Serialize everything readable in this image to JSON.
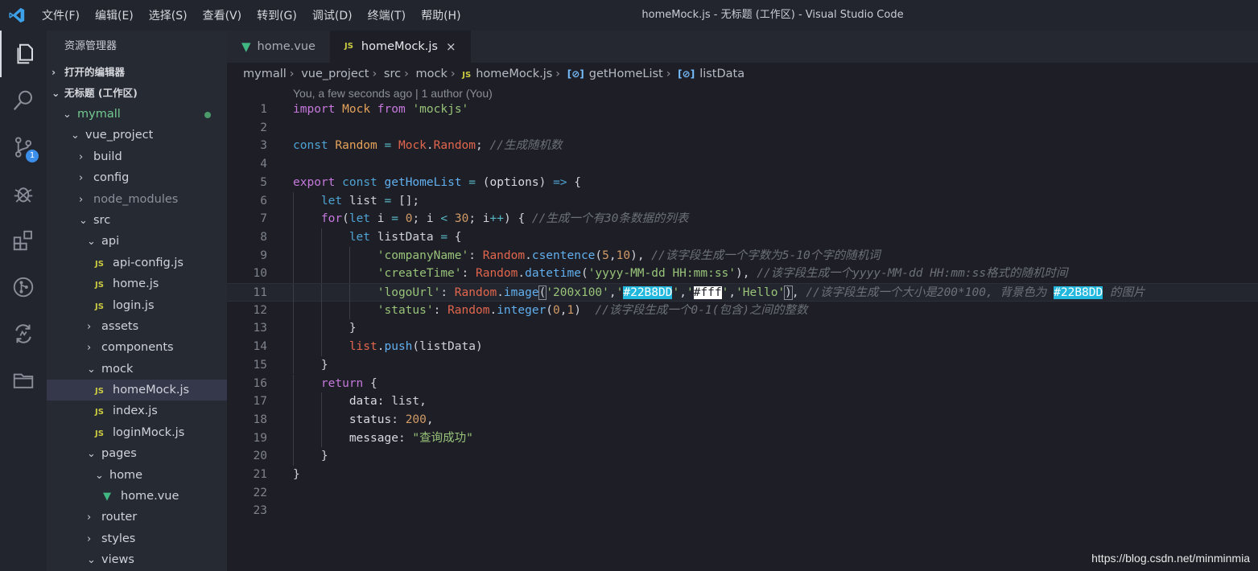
{
  "window": {
    "title": "homeMock.js - 无标题 (工作区) - Visual Studio Code"
  },
  "menu": [
    "文件(F)",
    "编辑(E)",
    "选择(S)",
    "查看(V)",
    "转到(G)",
    "调试(D)",
    "终端(T)",
    "帮助(H)"
  ],
  "activity_bar": {
    "items": [
      {
        "name": "explorer-icon",
        "active": true
      },
      {
        "name": "search-icon"
      },
      {
        "name": "source-control-icon",
        "badge": "1"
      },
      {
        "name": "debug-icon"
      },
      {
        "name": "extensions-icon"
      },
      {
        "name": "git-graph-icon"
      },
      {
        "name": "remote-sync-icon"
      },
      {
        "name": "folder-icon"
      }
    ]
  },
  "sidebar": {
    "title": "资源管理器",
    "sections": {
      "open_editors": "打开的编辑器",
      "workspace": "无标题 (工作区)"
    },
    "tree": [
      {
        "label": "mymall",
        "depth": 0,
        "kind": "folder-open",
        "style": "green",
        "dot": true
      },
      {
        "label": "vue_project",
        "depth": 1,
        "kind": "folder-open"
      },
      {
        "label": "build",
        "depth": 2,
        "kind": "folder"
      },
      {
        "label": "config",
        "depth": 2,
        "kind": "folder"
      },
      {
        "label": "node_modules",
        "depth": 2,
        "kind": "folder",
        "style": "dim"
      },
      {
        "label": "src",
        "depth": 2,
        "kind": "folder-open"
      },
      {
        "label": "api",
        "depth": 3,
        "kind": "folder-open"
      },
      {
        "label": "api-config.js",
        "depth": 4,
        "kind": "js"
      },
      {
        "label": "home.js",
        "depth": 4,
        "kind": "js"
      },
      {
        "label": "login.js",
        "depth": 4,
        "kind": "js"
      },
      {
        "label": "assets",
        "depth": 3,
        "kind": "folder"
      },
      {
        "label": "components",
        "depth": 3,
        "kind": "folder"
      },
      {
        "label": "mock",
        "depth": 3,
        "kind": "folder-open"
      },
      {
        "label": "homeMock.js",
        "depth": 4,
        "kind": "js",
        "selected": true
      },
      {
        "label": "index.js",
        "depth": 4,
        "kind": "js"
      },
      {
        "label": "loginMock.js",
        "depth": 4,
        "kind": "js"
      },
      {
        "label": "pages",
        "depth": 3,
        "kind": "folder-open"
      },
      {
        "label": "home",
        "depth": 4,
        "kind": "folder-open"
      },
      {
        "label": "home.vue",
        "depth": 5,
        "kind": "vue"
      },
      {
        "label": "router",
        "depth": 3,
        "kind": "folder"
      },
      {
        "label": "styles",
        "depth": 3,
        "kind": "folder"
      },
      {
        "label": "views",
        "depth": 3,
        "kind": "folder-open"
      }
    ]
  },
  "tabs": [
    {
      "label": "home.vue",
      "icon": "vue",
      "active": false
    },
    {
      "label": "homeMock.js",
      "icon": "js",
      "active": true,
      "close": "×"
    }
  ],
  "breadcrumb": [
    "mymall",
    "vue_project",
    "src",
    "mock",
    "homeMock.js",
    "getHomeList",
    "listData"
  ],
  "blame": "You, a few seconds ago | 1 author (You)",
  "current_line": 11,
  "code_lines": [
    {
      "n": "1",
      "indent": 0,
      "tokens": [
        [
          "kw",
          "import"
        ],
        [
          "pn",
          " "
        ],
        [
          "cls",
          "Mock"
        ],
        [
          "pn",
          " "
        ],
        [
          "kw",
          "from"
        ],
        [
          "pn",
          " "
        ],
        [
          "str",
          "'mockjs'"
        ]
      ]
    },
    {
      "n": "2",
      "indent": 0,
      "tokens": []
    },
    {
      "n": "3",
      "indent": 0,
      "tokens": [
        [
          "kb",
          "const"
        ],
        [
          "pn",
          " "
        ],
        [
          "cls",
          "Random"
        ],
        [
          "pn",
          " "
        ],
        [
          "op",
          "="
        ],
        [
          "pn",
          " "
        ],
        [
          "var",
          "Mock"
        ],
        [
          "pn",
          "."
        ],
        [
          "var",
          "Random"
        ],
        [
          "pn",
          "; "
        ],
        [
          "cmt",
          "//生成随机数"
        ]
      ]
    },
    {
      "n": "4",
      "indent": 0,
      "tokens": []
    },
    {
      "n": "5",
      "indent": 0,
      "tokens": [
        [
          "kw",
          "export"
        ],
        [
          "pn",
          " "
        ],
        [
          "kb",
          "const"
        ],
        [
          "pn",
          " "
        ],
        [
          "fn",
          "getHomeList"
        ],
        [
          "pn",
          " "
        ],
        [
          "op",
          "="
        ],
        [
          "pn",
          " ("
        ],
        [
          "prop",
          "options"
        ],
        [
          "pn",
          ") "
        ],
        [
          "kb",
          "=>"
        ],
        [
          "pn",
          " {"
        ]
      ]
    },
    {
      "n": "6",
      "indent": 1,
      "tokens": [
        [
          "kb",
          "let"
        ],
        [
          "pn",
          " list "
        ],
        [
          "op",
          "="
        ],
        [
          "pn",
          " [];"
        ]
      ]
    },
    {
      "n": "7",
      "indent": 1,
      "tokens": [
        [
          "kw",
          "for"
        ],
        [
          "pn",
          "("
        ],
        [
          "kb",
          "let"
        ],
        [
          "pn",
          " i "
        ],
        [
          "op",
          "="
        ],
        [
          "pn",
          " "
        ],
        [
          "num",
          "0"
        ],
        [
          "pn",
          "; i "
        ],
        [
          "op",
          "<"
        ],
        [
          "pn",
          " "
        ],
        [
          "num",
          "30"
        ],
        [
          "pn",
          "; i"
        ],
        [
          "op",
          "++"
        ],
        [
          "pn",
          ") { "
        ],
        [
          "cmt",
          "//生成一个有30条数据的列表"
        ]
      ]
    },
    {
      "n": "8",
      "indent": 2,
      "tokens": [
        [
          "kb",
          "let"
        ],
        [
          "pn",
          " listData "
        ],
        [
          "op",
          "="
        ],
        [
          "pn",
          " {"
        ]
      ]
    },
    {
      "n": "9",
      "indent": 3,
      "tokens": [
        [
          "str",
          "'companyName'"
        ],
        [
          "pn",
          ": "
        ],
        [
          "var",
          "Random"
        ],
        [
          "pn",
          "."
        ],
        [
          "fn",
          "csentence"
        ],
        [
          "pn",
          "("
        ],
        [
          "num",
          "5"
        ],
        [
          "pn",
          ","
        ],
        [
          "num",
          "10"
        ],
        [
          "pn",
          "), "
        ],
        [
          "cmt",
          "//该字段生成一个字数为5-10个字的随机词"
        ]
      ]
    },
    {
      "n": "10",
      "indent": 3,
      "tokens": [
        [
          "str",
          "'createTime'"
        ],
        [
          "pn",
          ": "
        ],
        [
          "var",
          "Random"
        ],
        [
          "pn",
          "."
        ],
        [
          "fn",
          "datetime"
        ],
        [
          "pn",
          "("
        ],
        [
          "str",
          "'yyyy-MM-dd HH:mm:ss'"
        ],
        [
          "pn",
          "), "
        ],
        [
          "cmt",
          "//该字段生成一个yyyy-MM-dd HH:mm:ss格式的随机时间"
        ]
      ]
    },
    {
      "n": "11",
      "indent": 3,
      "tokens": [
        [
          "str",
          "'logoUrl'"
        ],
        [
          "pn",
          ": "
        ],
        [
          "var",
          "Random"
        ],
        [
          "pn",
          "."
        ],
        [
          "fn",
          "image"
        ],
        [
          "brk",
          "("
        ],
        [
          "str",
          "'200x100'"
        ],
        [
          "pn",
          ","
        ],
        [
          "str",
          "'"
        ],
        [
          "sw1",
          "#22B8DD"
        ],
        [
          "str",
          "'"
        ],
        [
          "pn",
          ","
        ],
        [
          "str",
          "'"
        ],
        [
          "sw2",
          "#fff"
        ],
        [
          "str",
          "'"
        ],
        [
          "pn",
          ","
        ],
        [
          "str",
          "'Hello'"
        ],
        [
          "brk",
          ")"
        ],
        [
          "pn",
          ", "
        ],
        [
          "cmt",
          "//该字段生成一个大小是200*100, 背景色为 "
        ],
        [
          "sw1",
          "#22B8DD"
        ],
        [
          "cmt",
          " 的图片"
        ]
      ]
    },
    {
      "n": "12",
      "indent": 3,
      "tokens": [
        [
          "str",
          "'status'"
        ],
        [
          "pn",
          ": "
        ],
        [
          "var",
          "Random"
        ],
        [
          "pn",
          "."
        ],
        [
          "fn",
          "integer"
        ],
        [
          "pn",
          "("
        ],
        [
          "num",
          "0"
        ],
        [
          "pn",
          ","
        ],
        [
          "num",
          "1"
        ],
        [
          "pn",
          ")  "
        ],
        [
          "cmt",
          "//该字段生成一个0-1(包含)之间的整数"
        ]
      ]
    },
    {
      "n": "13",
      "indent": 2,
      "tokens": [
        [
          "pn",
          "}"
        ]
      ]
    },
    {
      "n": "14",
      "indent": 2,
      "tokens": [
        [
          "var",
          "list"
        ],
        [
          "pn",
          "."
        ],
        [
          "fn",
          "push"
        ],
        [
          "pn",
          "(listData)"
        ]
      ]
    },
    {
      "n": "15",
      "indent": 1,
      "tokens": [
        [
          "pn",
          "}"
        ]
      ]
    },
    {
      "n": "16",
      "indent": 1,
      "tokens": [
        [
          "kw",
          "return"
        ],
        [
          "pn",
          " {"
        ]
      ]
    },
    {
      "n": "17",
      "indent": 2,
      "tokens": [
        [
          "prop",
          "data"
        ],
        [
          "pn",
          ": list,"
        ]
      ]
    },
    {
      "n": "18",
      "indent": 2,
      "tokens": [
        [
          "prop",
          "status"
        ],
        [
          "pn",
          ": "
        ],
        [
          "num",
          "200"
        ],
        [
          "pn",
          ","
        ]
      ]
    },
    {
      "n": "19",
      "indent": 2,
      "tokens": [
        [
          "prop",
          "message"
        ],
        [
          "pn",
          ": "
        ],
        [
          "str",
          "\"查询成功\""
        ]
      ]
    },
    {
      "n": "20",
      "indent": 1,
      "tokens": [
        [
          "pn",
          "}"
        ]
      ]
    },
    {
      "n": "21",
      "indent": 0,
      "tokens": [
        [
          "pn",
          "}"
        ]
      ]
    },
    {
      "n": "22",
      "indent": 0,
      "tokens": []
    },
    {
      "n": "23",
      "indent": 0,
      "tokens": []
    }
  ],
  "watermark": "https://blog.csdn.net/minminmia",
  "colors": {
    "accent": "#3b8eea",
    "swatch_bg": "#22B8DD",
    "selection": "#34384a"
  }
}
